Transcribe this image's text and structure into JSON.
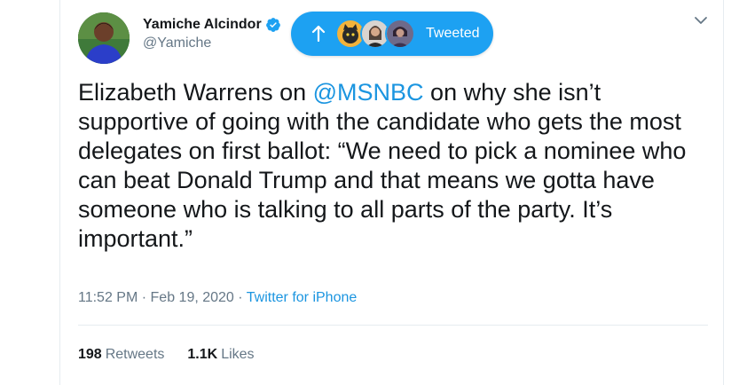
{
  "author": {
    "display_name": "Yamiche Alcindor",
    "handle": "@Yamiche",
    "verified": true
  },
  "banner": {
    "label": "Tweeted",
    "arrow_icon": "up-arrow-icon"
  },
  "tweet": {
    "text_before_mention": "Elizabeth Warrens on ",
    "mention": "@MSNBC",
    "text_after_mention": " on why she isn’t supportive of going with the candidate who gets the most delegates on first ballot: “We need to pick a nominee who can beat Donald Trump and that means we gotta have someone who is talking to all parts of the party. It’s important.”"
  },
  "meta": {
    "time": "11:52 PM",
    "separator": "·",
    "date": "Feb 19, 2020",
    "separator2": "·",
    "source": "Twitter for iPhone"
  },
  "stats": {
    "retweets_count": "198",
    "retweets_label": "Retweets",
    "likes_count": "1.1K",
    "likes_label": "Likes"
  },
  "colors": {
    "accent": "#1da1f2",
    "link": "#1b95e0",
    "muted": "#657786",
    "text": "#14171a",
    "divider": "#e6ecf0"
  }
}
